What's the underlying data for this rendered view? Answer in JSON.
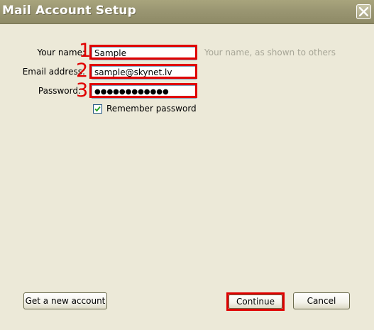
{
  "window": {
    "title": "Mail Account Setup",
    "close_icon": "close-icon"
  },
  "form": {
    "name_label": "Your name:",
    "name_value": "Sample",
    "name_hint": "Your name, as shown to others",
    "email_label": "Email address:",
    "email_value": "sample@skynet.lv",
    "password_label": "Password:",
    "password_value": "●●●●●●●●●●●●",
    "remember_label": "Remember password",
    "remember_checked": true
  },
  "annotations": {
    "step1": "1",
    "step2": "2",
    "step3": "3",
    "highlight_color": "#e00000"
  },
  "buttons": {
    "new_account": "Get a new account",
    "continue": "Continue",
    "cancel": "Cancel"
  }
}
